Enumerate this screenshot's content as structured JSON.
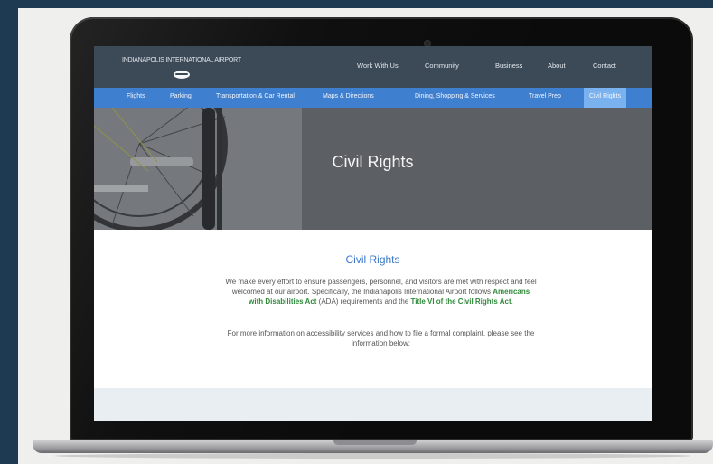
{
  "site": {
    "brand_name": "INDIANAPOLIS INTERNATIONAL AIRPORT",
    "top_nav": [
      "Work With Us",
      "Community",
      "Business",
      "About",
      "Contact"
    ],
    "main_nav": [
      "Flights",
      "Parking",
      "Transportation & Car Rental",
      "Maps & Directions",
      "Dining, Shopping & Services",
      "Travel Prep",
      "Civil Rights"
    ],
    "active_nav": "Civil Rights"
  },
  "hero": {
    "title": "Civil Rights"
  },
  "content": {
    "heading": "Civil Rights",
    "para1_before": "We make every effort to ensure passengers, personnel, and visitors are met with respect and feel welcomed at our airport. Specifically, the Indianapolis International Airport follows ",
    "para1_link1": "Americans with Disabilities Act",
    "para1_middle": " (ADA) requirements and the ",
    "para1_link2": "Title VI of the Civil Rights Act",
    "para1_after": ".",
    "para2": "For more information on accessibility services and how to file a formal complaint, please see the information below:"
  },
  "colors": {
    "header_bg": "#3c4a58",
    "nav_bg": "#3f7fd0",
    "nav_active_bg": "#7ab2ef",
    "heading_color": "#3b78c8",
    "link_color": "#2f8a3a",
    "page_bg": "#1e3a52"
  }
}
